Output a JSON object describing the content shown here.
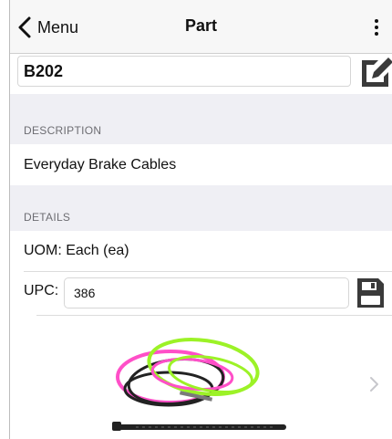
{
  "nav": {
    "back_label": "Menu",
    "title": "Part"
  },
  "part": {
    "number": "B202"
  },
  "description": {
    "header": "DESCRIPTION",
    "value": "Everyday Brake Cables"
  },
  "details": {
    "header": "DETAILS",
    "uom_text": "UOM: Each (ea)",
    "upc_label": "UPC:",
    "upc_value": "386"
  },
  "image": {
    "icon": "brake-cables-photo",
    "cable_colors": [
      "#ff4fc8",
      "#9cf227",
      "#1a1a1a"
    ]
  },
  "icons": {
    "back": "chevron-left-icon",
    "more": "more-vertical-icon",
    "edit": "edit-icon",
    "save": "floppy-disk-icon",
    "row": "chevron-right-icon"
  }
}
